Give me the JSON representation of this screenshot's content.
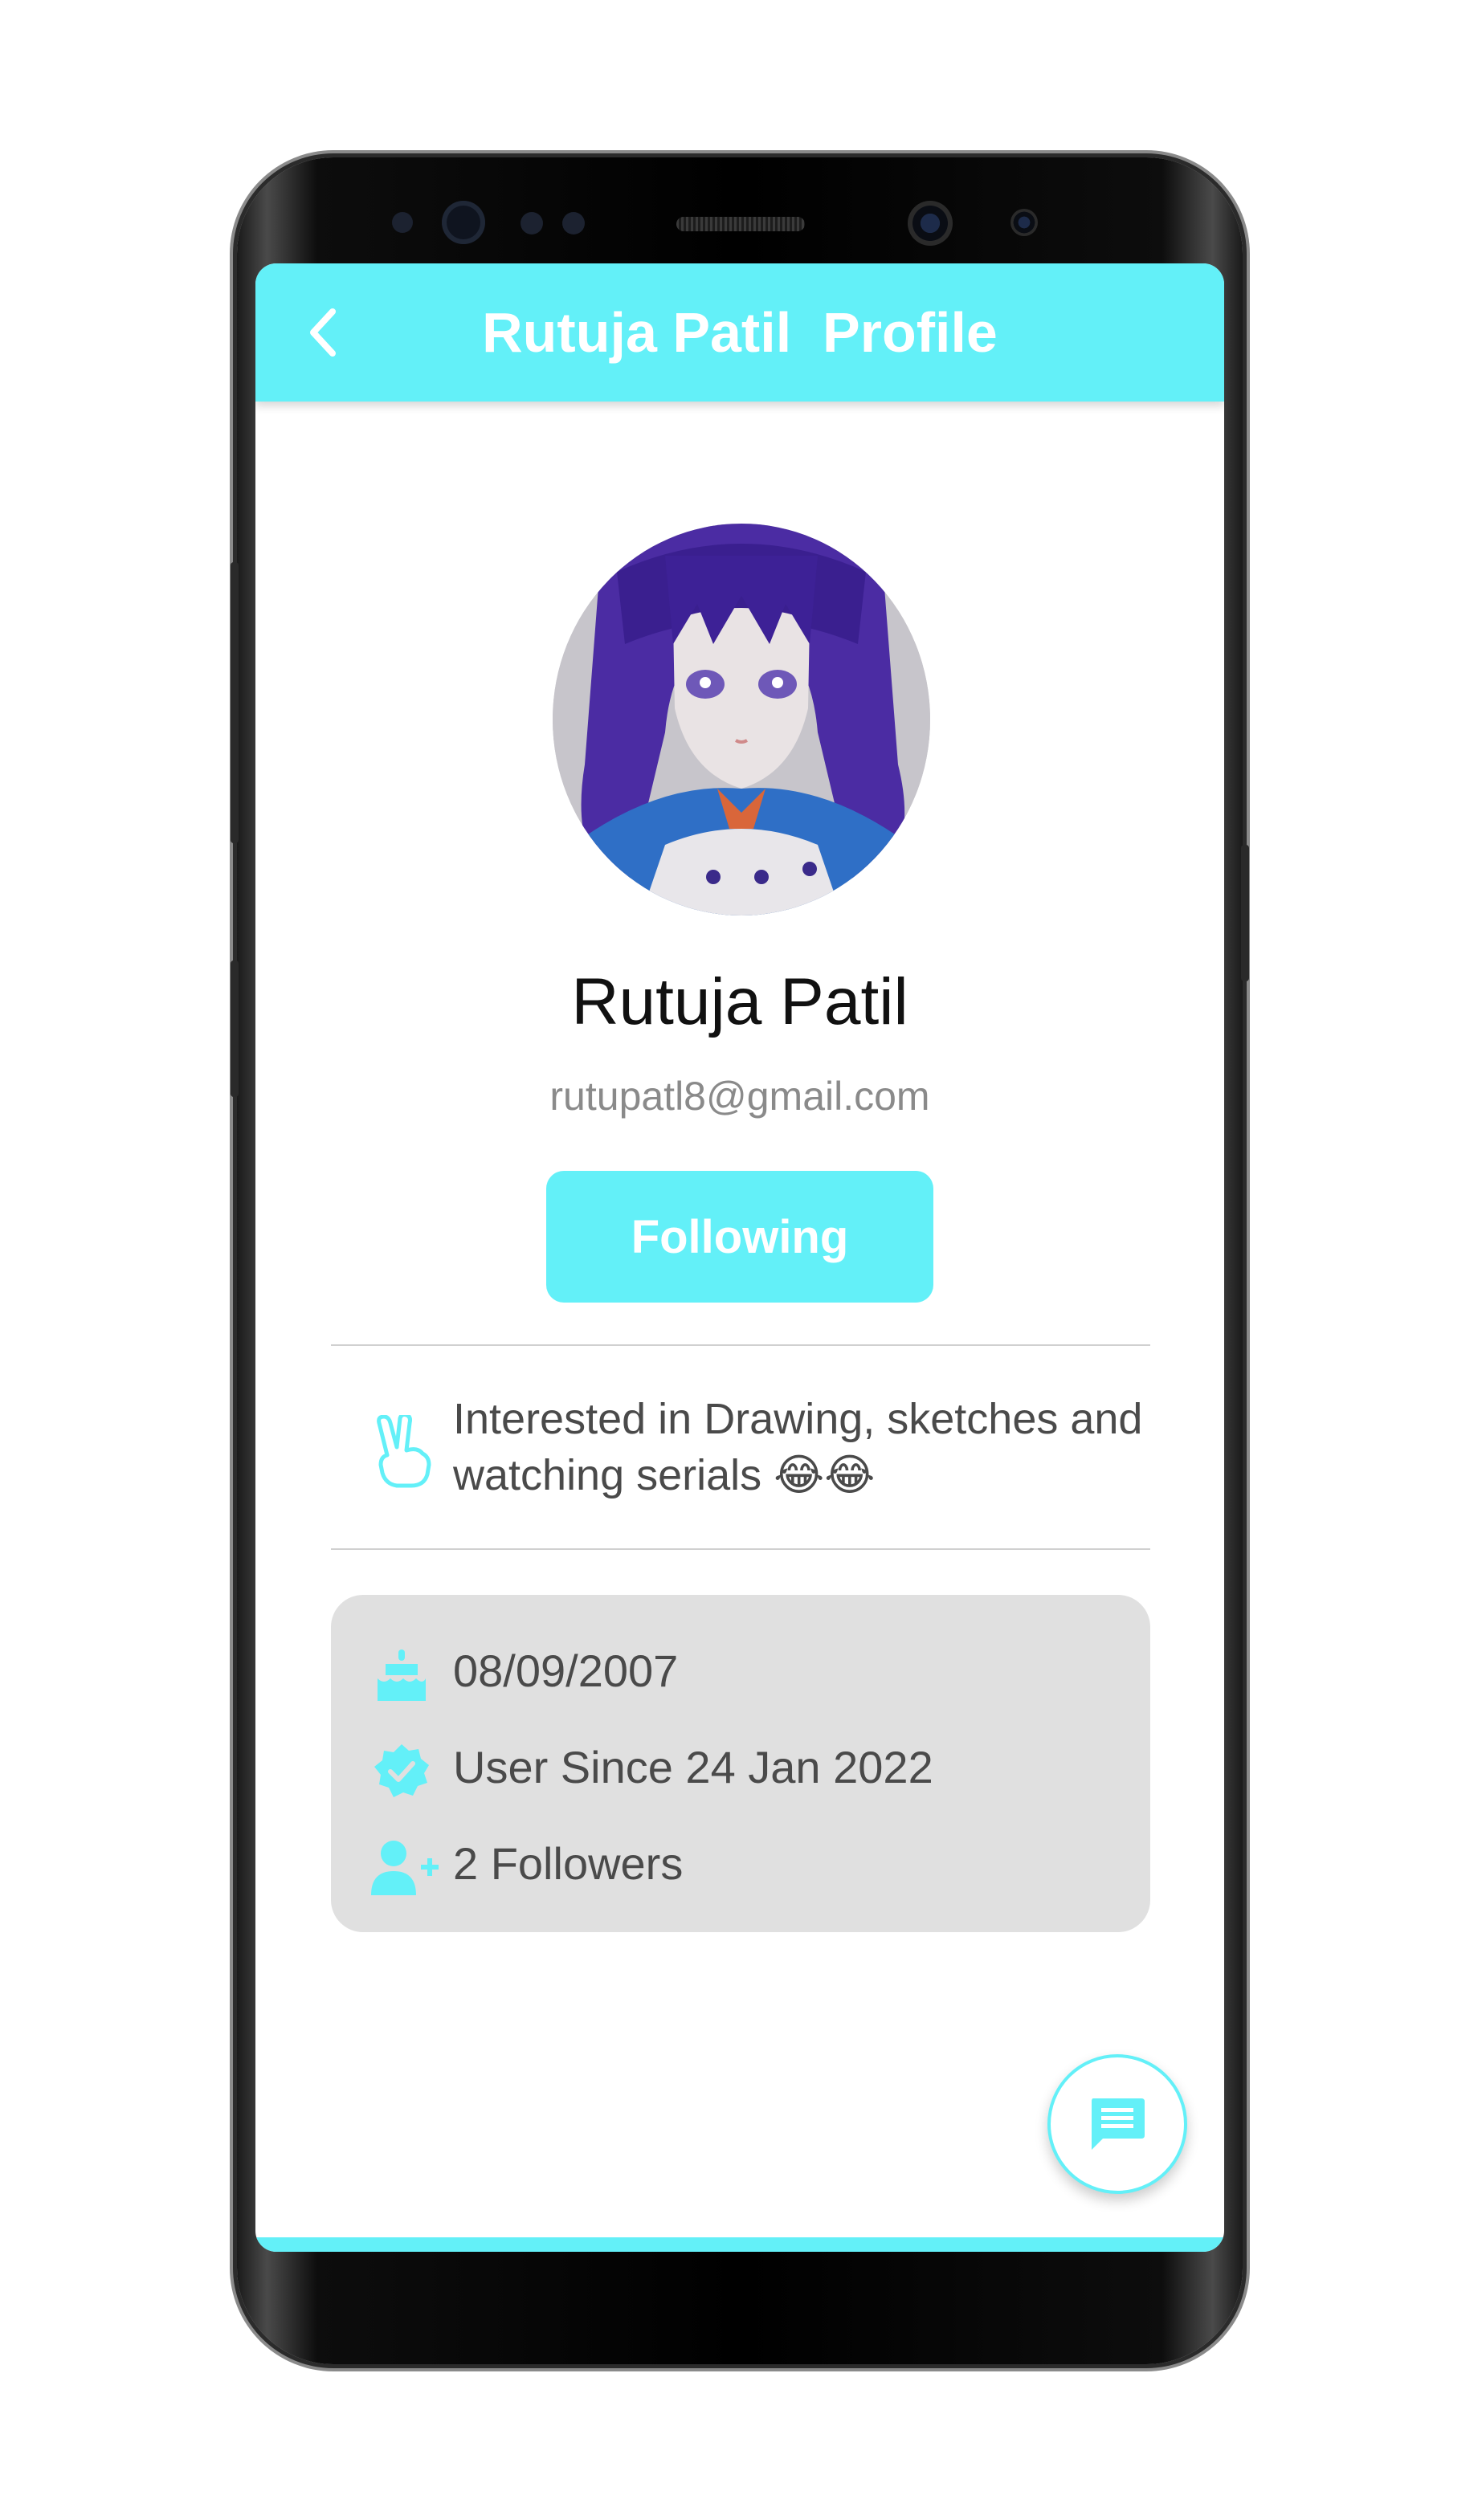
{
  "theme": {
    "accent": "#63f0f8",
    "text_primary": "#111111",
    "text_secondary": "#4a4a4a",
    "muted": "#8a8a8a",
    "card_bg": "#e0e0e0"
  },
  "appbar": {
    "title": "Rutuja Patil  Profile",
    "back_icon": "chevron-left-icon"
  },
  "profile": {
    "name": "Rutuja Patil",
    "email": "rutupatl8@gmail.com",
    "follow_button_label": "Following"
  },
  "bio": {
    "icon": "victory-hand-icon",
    "text": "Interested in Drawing, sketches and watching serials 😂😂"
  },
  "info": [
    {
      "icon": "birthday-cake-icon",
      "text": "08/09/2007"
    },
    {
      "icon": "verified-badge-icon",
      "text": "User Since 24 Jan 2022"
    },
    {
      "icon": "add-person-icon",
      "text": "2 Followers"
    }
  ],
  "fab": {
    "icon": "chat-message-icon"
  }
}
